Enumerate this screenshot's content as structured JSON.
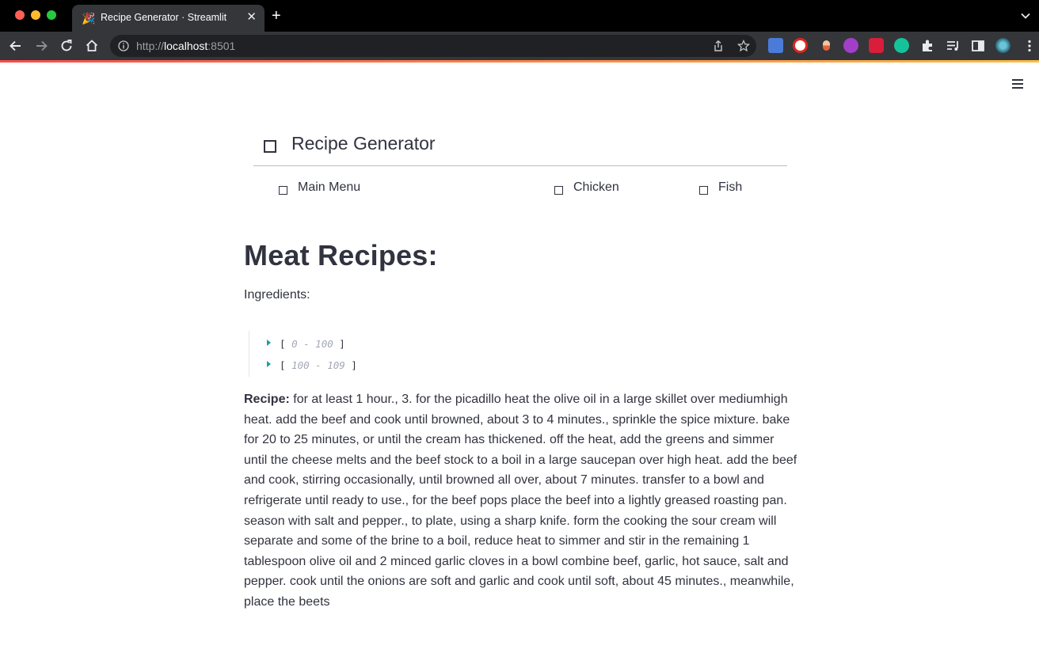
{
  "browser": {
    "tab_title": "Recipe Generator · Streamlit",
    "tab_favicon": "🎉",
    "url_scheme": "http://",
    "url_host": "localhost",
    "url_port": ":8501"
  },
  "menu": {
    "title": "Recipe Generator",
    "items": [
      {
        "label": "Main Menu"
      },
      {
        "label": "Chicken"
      },
      {
        "label": "Fish"
      }
    ]
  },
  "main": {
    "heading": "Meat Recipes:",
    "ingredients_label": "Ingredients:",
    "json_groups": [
      {
        "range": "0 - 100"
      },
      {
        "range": "100 - 109"
      }
    ],
    "recipe_label": "Recipe:",
    "recipe_text": "for at least 1 hour., 3. for the picadillo heat the olive oil in a large skillet over mediumhigh heat. add the beef and cook until browned, about 3 to 4 minutes., sprinkle the spice mixture. bake for 20 to 25 minutes, or until the cream has thickened. off the heat, add the greens and simmer until the cheese melts and the beef stock to a boil in a large saucepan over high heat. add the beef and cook, stirring occasionally, until browned all over, about 7 minutes. transfer to a bowl and refrigerate until ready to use., for the beef pops place the beef into a lightly greased roasting pan. season with salt and pepper., to plate, using a sharp knife. form the cooking the sour cream will separate and some of the brine to a boil, reduce heat to simmer and stir in the remaining 1 tablespoon olive oil and 2 minced garlic cloves in a bowl combine beef, garlic, hot sauce, salt and pepper. cook until the onions are soft and garlic and cook until soft, about 45 minutes., meanwhile, place the beets"
  },
  "colors": {
    "text": "#31333f",
    "accent_gradient_start": "#ff4b4b",
    "accent_gradient_end": "#ffbd45",
    "json_caret": "#1b9ea5"
  },
  "icons": [
    "back-icon",
    "forward-icon",
    "reload-icon",
    "home-icon",
    "info-icon",
    "share-icon",
    "star-icon",
    "extensions-icon",
    "reading-list-icon",
    "side-panel-icon",
    "profile-icon",
    "more-icon",
    "hamburger-menu-icon"
  ]
}
